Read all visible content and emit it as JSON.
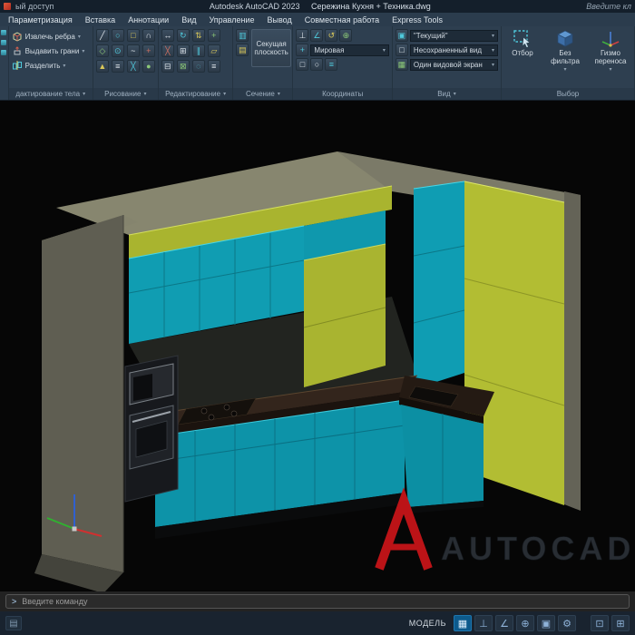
{
  "titlebar": {
    "shared_label": "ый доступ",
    "app_title": "Autodesk AutoCAD 2023",
    "doc_title": "Сережина Кухня + Техника.dwg",
    "search_text": "Введите кл"
  },
  "tabs": [
    "Параметризация",
    "Вставка",
    "Аннотации",
    "Вид",
    "Управление",
    "Вывод",
    "Совместная работа",
    "Express Tools"
  ],
  "icons": {
    "dropdown_arrow": "▾"
  },
  "ribbon": {
    "solid_buttons": [
      {
        "label": "Извлечь ребра"
      },
      {
        "label": "Выдавить грани"
      },
      {
        "label": "Разделить"
      }
    ],
    "solid_label": "дактирование тела",
    "draw_icons": [
      "╱",
      "○",
      "□",
      "∩",
      "◇",
      "⊙",
      "~",
      "+",
      "▲",
      "≡",
      "╳",
      "●"
    ],
    "draw_label": "Рисование",
    "modify_icons": [
      "↔",
      "↻",
      "⇅",
      "+",
      "╳",
      "⊞",
      "∥",
      "▱",
      "⊟",
      "⊠",
      "◌",
      "≡"
    ],
    "modify_label": "Редактирование",
    "section_icons": [
      "▥",
      "▤"
    ],
    "section_button": "Секущая плоскость",
    "section_label": "Сечение",
    "coord_icons": [
      "⊥",
      "∠",
      "↺",
      "⊕",
      "+",
      "□",
      "○",
      "≡"
    ],
    "ucs_dropdown": "Мировая",
    "coords_label": "Координаты",
    "view_row_icons": [
      "▣",
      "□",
      "▦"
    ],
    "view_style_dropdown": "\"Текущий\"",
    "view_named": "Несохраненный вид",
    "view_viewport": "Один видовой экран",
    "view_label": "Вид",
    "select_button": "Отбор",
    "filter_button": "Без фильтра",
    "gizmo_button": "Гизмо переноса",
    "selection_label": "Выбор"
  },
  "viewport": {
    "watermark": "AUTOCAD"
  },
  "command_line": {
    "icon": ">",
    "prompt": "Введите команду"
  },
  "statusbar": {
    "left_icon": "▤",
    "model_label": "МОДЕЛЬ",
    "icons": [
      {
        "name": "grid",
        "glyph": "▦"
      },
      {
        "name": "snap",
        "glyph": "⊥"
      },
      {
        "name": "polar",
        "glyph": "∠"
      },
      {
        "name": "osnap",
        "glyph": "⊕"
      },
      {
        "name": "dynamic-ucs",
        "glyph": "▣"
      },
      {
        "name": "settings",
        "glyph": "⚙"
      },
      {
        "name": "isolate",
        "glyph": "⊡"
      },
      {
        "name": "clean-screen",
        "glyph": "⊞"
      }
    ]
  }
}
